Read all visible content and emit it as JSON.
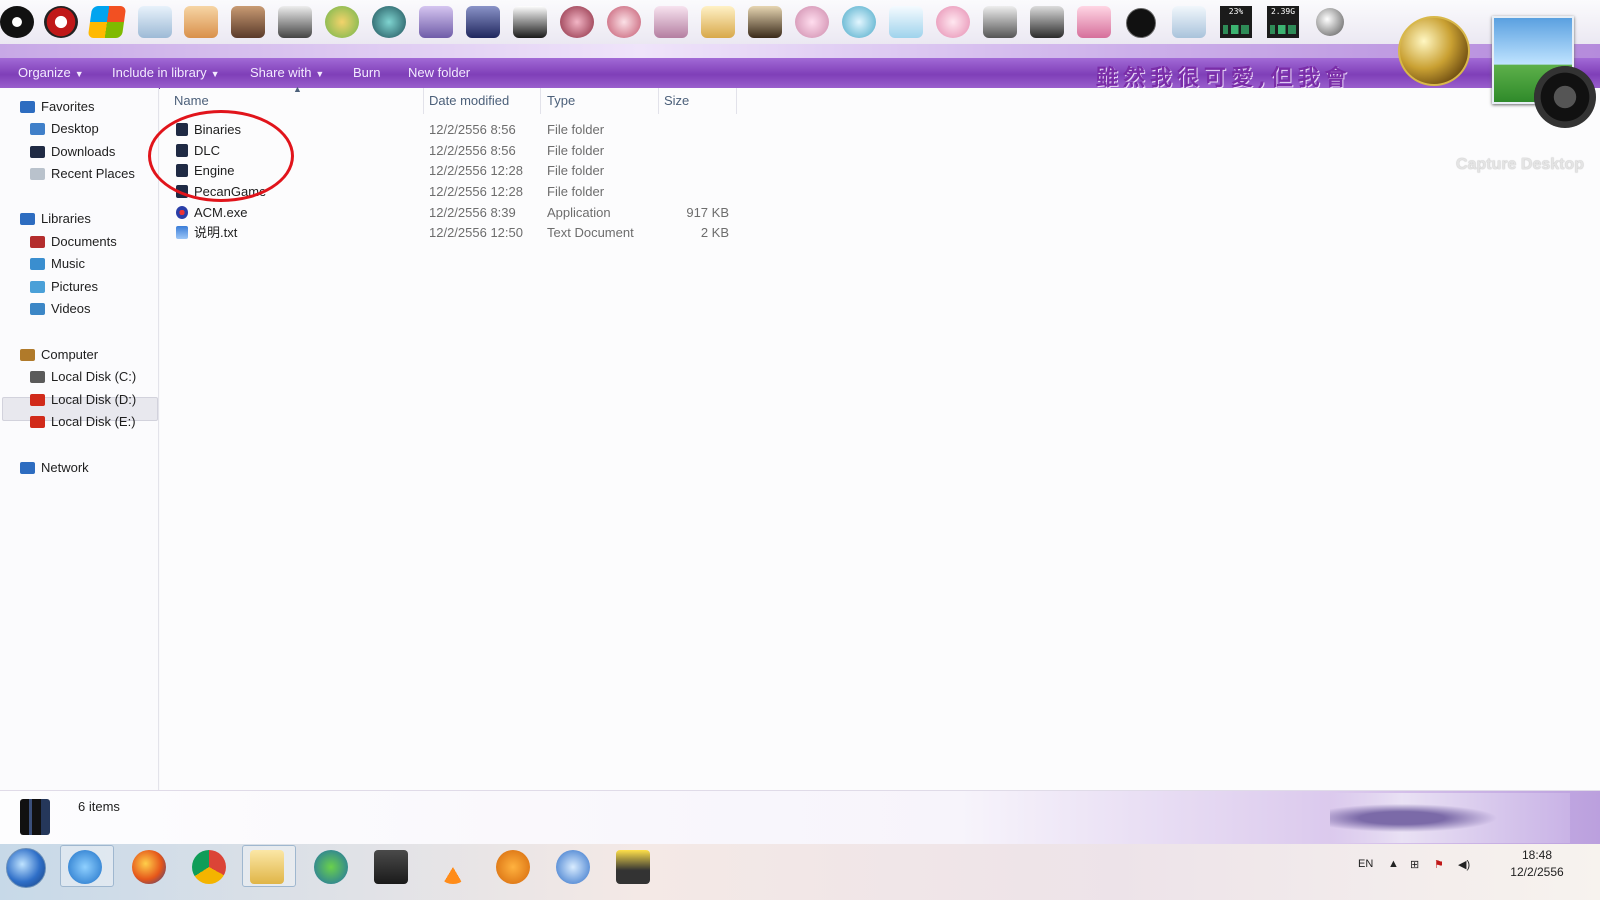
{
  "dock": {
    "icons": [
      "steam-icon",
      "app-red-icon",
      "windows-flag-icon",
      "recycle-bin-icon",
      "anime-1-icon",
      "anime-2-icon",
      "anime-3-icon",
      "anime-4-icon",
      "anime-5-icon",
      "anime-6-icon",
      "dvd-anime-icon",
      "anime-7-icon",
      "anime-8-icon",
      "anime-9-icon",
      "anime-10-icon",
      "anime-11-icon",
      "anime-12-icon",
      "anime-13-icon",
      "anime-14-icon",
      "anime-15-icon",
      "anime-16-icon",
      "anime-17-icon",
      "anime-18-icon",
      "anime-19-icon",
      "clock-icon",
      "recycle-bin-2-icon"
    ],
    "cpu_meter": "23%",
    "mem_meter": "2.39G"
  },
  "toolbar": {
    "organize": "Organize",
    "include_in_library": "Include in library",
    "share_with": "Share with",
    "burn": "Burn",
    "new_folder": "New folder"
  },
  "banner_text": "雖然我很可愛,但我會",
  "capture_label": "Capture Desktop",
  "nav": {
    "favorites": "Favorites",
    "desktop": "Desktop",
    "downloads": "Downloads",
    "recent_places": "Recent Places",
    "libraries": "Libraries",
    "documents": "Documents",
    "music": "Music",
    "pictures": "Pictures",
    "videos": "Videos",
    "computer": "Computer",
    "local_c": "Local Disk (C:)",
    "local_d": "Local Disk (D:)",
    "local_e": "Local Disk (E:)",
    "network": "Network"
  },
  "columns": {
    "name": "Name",
    "date_modified": "Date modified",
    "type": "Type",
    "size": "Size"
  },
  "files": [
    {
      "name": "Binaries",
      "date": "12/2/2556 8:56",
      "type": "File folder",
      "size": ""
    },
    {
      "name": "DLC",
      "date": "12/2/2556 8:56",
      "type": "File folder",
      "size": ""
    },
    {
      "name": "Engine",
      "date": "12/2/2556 12:28",
      "type": "File folder",
      "size": ""
    },
    {
      "name": "PecanGame",
      "date": "12/2/2556 12:28",
      "type": "File folder",
      "size": ""
    },
    {
      "name": "ACM.exe",
      "date": "12/2/2556 8:39",
      "type": "Application",
      "size": "917 KB"
    },
    {
      "name": "说明.txt",
      "date": "12/2/2556 12:50",
      "type": "Text Document",
      "size": "2 KB"
    }
  ],
  "status": {
    "item_count": "6 items"
  },
  "taskbar": {
    "lang": "EN",
    "time": "18:48",
    "date": "12/2/2556"
  },
  "colors": {
    "toolbar_purple": "#7f3fb8",
    "annotation_red": "#e1141b",
    "accent_blue": "#1f2a44"
  }
}
